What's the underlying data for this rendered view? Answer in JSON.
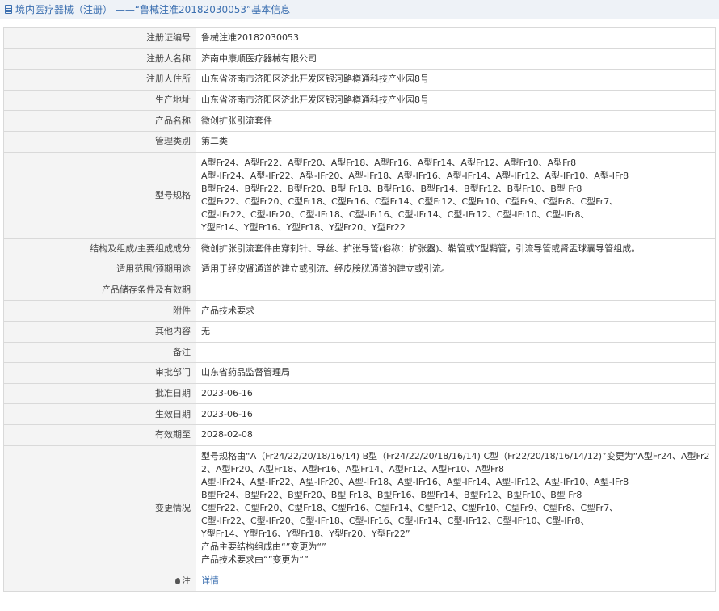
{
  "header": {
    "title": "境内医疗器械（注册） ——“鲁械注准20182030053”基本信息"
  },
  "rows": {
    "reg_no": {
      "label": "注册证编号",
      "value": "鲁械注准20182030053"
    },
    "registrant": {
      "label": "注册人名称",
      "value": "济南中康顺医疗器械有限公司"
    },
    "address": {
      "label": "注册人住所",
      "value": "山东省济南市济阳区济北开发区银河路樽通科技产业园8号"
    },
    "production": {
      "label": "生产地址",
      "value": "山东省济南市济阳区济北开发区银河路樽通科技产业园8号"
    },
    "product_name": {
      "label": "产品名称",
      "value": "微创扩张引流套件"
    },
    "category": {
      "label": "管理类别",
      "value": "第二类"
    },
    "models": {
      "label": "型号规格",
      "lines": [
        "A型Fr24、A型Fr22、A型Fr20、A型Fr18、A型Fr16、A型Fr14、A型Fr12、A型Fr10、A型Fr8",
        "A型-ⅠFr24、A型-ⅠFr22、A型-ⅠFr20、A型-ⅠFr18、A型-ⅠFr16、A型-ⅠFr14、A型-ⅠFr12、A型-ⅠFr10、A型-ⅠFr8",
        "B型Fr24、B型Fr22、B型Fr20、B型 Fr18、B型Fr16、B型Fr14、B型Fr12、B型Fr10、B型 Fr8",
        "C型Fr22、C型Fr20、C型Fr18、C型Fr16、C型Fr14、C型Fr12、C型Fr10、C型Fr9、C型Fr8、C型Fr7、",
        "C型-ⅠFr22、C型-ⅠFr20、C型-ⅠFr18、C型-ⅠFr16、C型-ⅠFr14、C型-ⅠFr12、C型-ⅠFr10、C型-ⅠFr8、",
        "Y型Fr14、Y型Fr16、Y型Fr18、Y型Fr20、Y型Fr22"
      ]
    },
    "structure": {
      "label": "结构及组成/主要组成成分",
      "value": "微创扩张引流套件由穿刺针、导丝、扩张导管(俗称：扩张器)、鞘管或Y型鞘管，引流导管或肾盂球囊导管组成。"
    },
    "scope": {
      "label": "适用范围/预期用途",
      "value": "适用于经皮肾通道的建立或引流、经皮膀胱通道的建立或引流。"
    },
    "storage": {
      "label": "产品储存条件及有效期",
      "value": ""
    },
    "attachment": {
      "label": "附件",
      "value": "产品技术要求"
    },
    "other": {
      "label": "其他内容",
      "value": "无"
    },
    "remark": {
      "label": "备注",
      "value": ""
    },
    "department": {
      "label": "审批部门",
      "value": "山东省药品监督管理局"
    },
    "approval_date": {
      "label": "批准日期",
      "value": "2023-06-16"
    },
    "effective_date": {
      "label": "生效日期",
      "value": "2023-06-16"
    },
    "expiry_date": {
      "label": "有效期至",
      "value": "2028-02-08"
    },
    "changes": {
      "label": "变更情况",
      "lines": [
        "型号规格由“A（Fr24/22/20/18/16/14) B型（Fr24/22/20/18/16/14) C型（Fr22/20/18/16/14/12)”变更为“A型Fr24、A型Fr2",
        "2、A型Fr20、A型Fr18、A型Fr16、A型Fr14、A型Fr12、A型Fr10、A型Fr8",
        "A型-ⅠFr24、A型-ⅠFr22、A型-ⅠFr20、A型-ⅠFr18、A型-ⅠFr16、A型-ⅠFr14、A型-ⅠFr12、A型-ⅠFr10、A型-ⅠFr8",
        "B型Fr24、B型Fr22、B型Fr20、B型 Fr18、B型Fr16、B型Fr14、B型Fr12、B型Fr10、B型 Fr8",
        "C型Fr22、C型Fr20、C型Fr18、C型Fr16、C型Fr14、C型Fr12、C型Fr10、C型Fr9、C型Fr8、C型Fr7、",
        "C型-ⅠFr22、C型-ⅠFr20、C型-ⅠFr18、C型-ⅠFr16、C型-ⅠFr14、C型-ⅠFr12、C型-ⅠFr10、C型-ⅠFr8、",
        "Y型Fr14、Y型Fr16、Y型Fr18、Y型Fr20、Y型Fr22”",
        "产品主要结构组成由“”变更为“”",
        "产品技术要求由“”变更为“”"
      ]
    },
    "note": {
      "label": "注",
      "value": "详情"
    }
  }
}
